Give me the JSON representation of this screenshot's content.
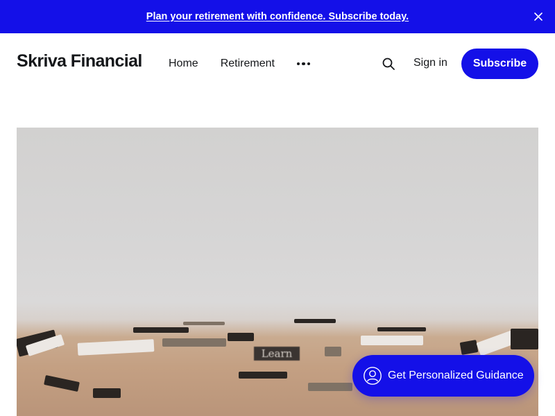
{
  "announcement": {
    "text": "Plan your retirement with confidence. Subscribe today.",
    "close_icon": "close-icon"
  },
  "header": {
    "site_title": "Skriva Financial",
    "nav": [
      {
        "label": "Home"
      },
      {
        "label": "Retirement"
      }
    ],
    "more_icon": "ellipsis-icon",
    "search_icon": "search-icon",
    "signin_label": "Sign in",
    "subscribe_label": "Subscribe"
  },
  "hero": {
    "image_text": "Learn"
  },
  "guidance_button": {
    "label": "Get Personalized Guidance",
    "icon": "user-circle-icon"
  },
  "colors": {
    "accent": "#1410e8",
    "text": "#15171a",
    "background": "#ffffff"
  }
}
